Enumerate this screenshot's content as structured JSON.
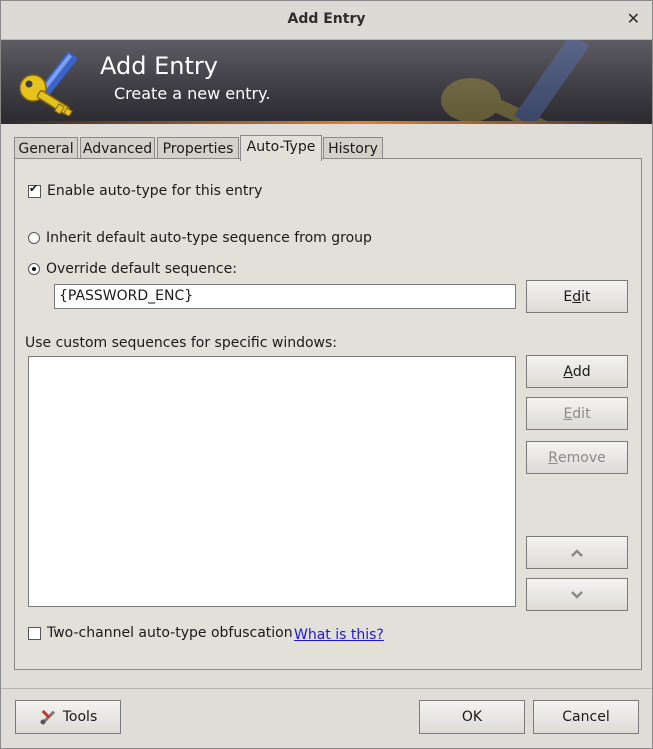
{
  "window": {
    "title": "Add Entry",
    "close_glyph": "✕"
  },
  "banner": {
    "title": "Add Entry",
    "subtitle": "Create a new entry.",
    "icon": "key-pen-icon"
  },
  "tabs": [
    {
      "label": "General",
      "active": false
    },
    {
      "label": "Advanced",
      "active": false
    },
    {
      "label": "Properties",
      "active": false
    },
    {
      "label": "Auto-Type",
      "active": true
    },
    {
      "label": "History",
      "active": false
    }
  ],
  "autotype": {
    "enable_label": "Enable auto-type for this entry",
    "enable_checked": true,
    "inherit_label": "Inherit default auto-type sequence from group",
    "inherit_selected": false,
    "override_label": "Override default sequence:",
    "override_selected": true,
    "sequence_value": "{PASSWORD_ENC}",
    "edit_sequence_label_pre": "E",
    "edit_sequence_label_acc": "d",
    "edit_sequence_label_post": "it",
    "custom_label": "Use custom sequences for specific windows:",
    "add_pre": "",
    "add_acc": "A",
    "add_post": "dd",
    "edit_pre": "",
    "edit_acc": "E",
    "edit_post": "dit",
    "remove_pre": "",
    "remove_acc": "R",
    "remove_post": "emove",
    "move_up_icon": "chevron-up-icon",
    "move_down_icon": "chevron-down-icon",
    "obfuscation_label": "Two-channel auto-type obfuscation",
    "obfuscation_checked": false,
    "what_is_this": "What is this?"
  },
  "footer": {
    "tools_label": "Tools",
    "tools_icon": "tools-icon",
    "ok_label": "OK",
    "cancel_label": "Cancel"
  },
  "colors": {
    "banner_dark": "#3c3c42",
    "accent_orange": "#e0822e",
    "link": "#1a1ad6"
  }
}
